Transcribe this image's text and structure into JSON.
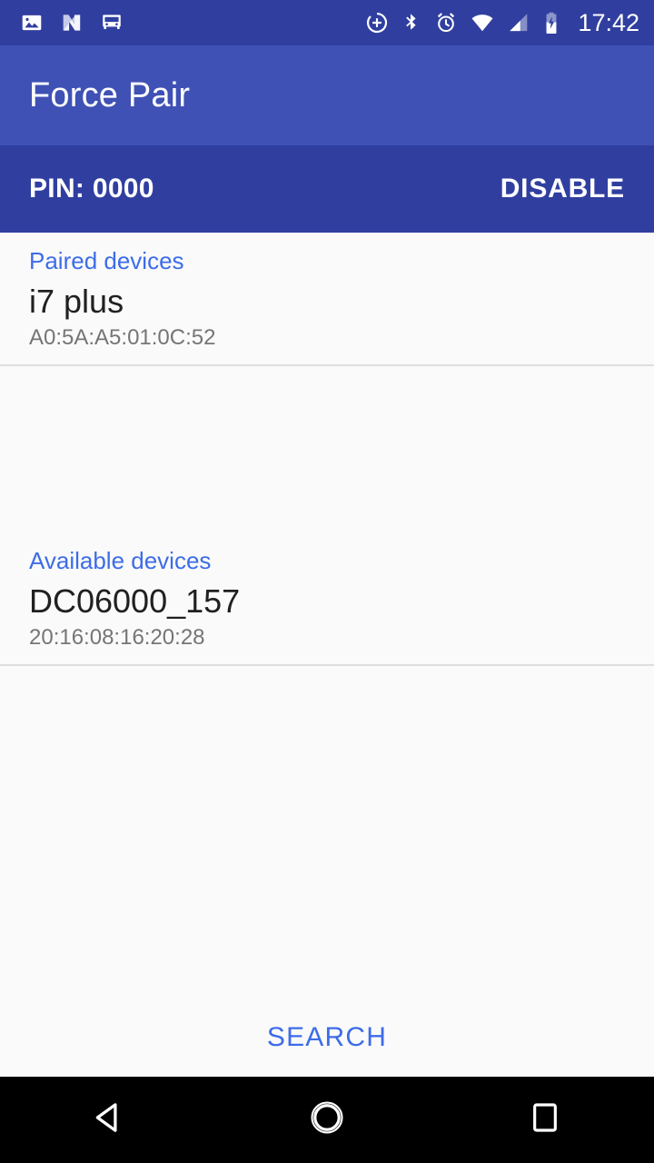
{
  "status_bar": {
    "time": "17:42",
    "left_icons": [
      {
        "name": "image-icon"
      },
      {
        "name": "android-n-logo-icon"
      },
      {
        "name": "bus-transit-icon"
      }
    ],
    "right_icons": [
      {
        "name": "add-circle-icon"
      },
      {
        "name": "bluetooth-icon"
      },
      {
        "name": "alarm-clock-icon"
      },
      {
        "name": "wifi-icon"
      },
      {
        "name": "cellular-signal-icon"
      },
      {
        "name": "battery-charging-icon"
      }
    ],
    "background_color": "#303F9F"
  },
  "app_bar": {
    "title": "Force Pair",
    "background_color": "#3F51B5",
    "text_color": "#FFFFFF"
  },
  "pin_bar": {
    "pin_label": "PIN: 0000",
    "disable_label": "DISABLE",
    "background_color": "#303F9F",
    "text_color": "#FFFFFF"
  },
  "content": {
    "background_color": "#FAFAFA",
    "accent_color": "#3D6CE8",
    "paired_section": {
      "header": "Paired devices",
      "devices": [
        {
          "name": "i7 plus",
          "mac": "A0:5A:A5:01:0C:52"
        }
      ]
    },
    "available_section": {
      "header": "Available devices",
      "devices": [
        {
          "name": "DC06000_157",
          "mac": "20:16:08:16:20:28"
        }
      ]
    },
    "search_label": "SEARCH"
  },
  "nav_bar": {
    "background_color": "#000000",
    "buttons": [
      {
        "name": "back-button"
      },
      {
        "name": "home-button"
      },
      {
        "name": "recents-button"
      }
    ]
  }
}
